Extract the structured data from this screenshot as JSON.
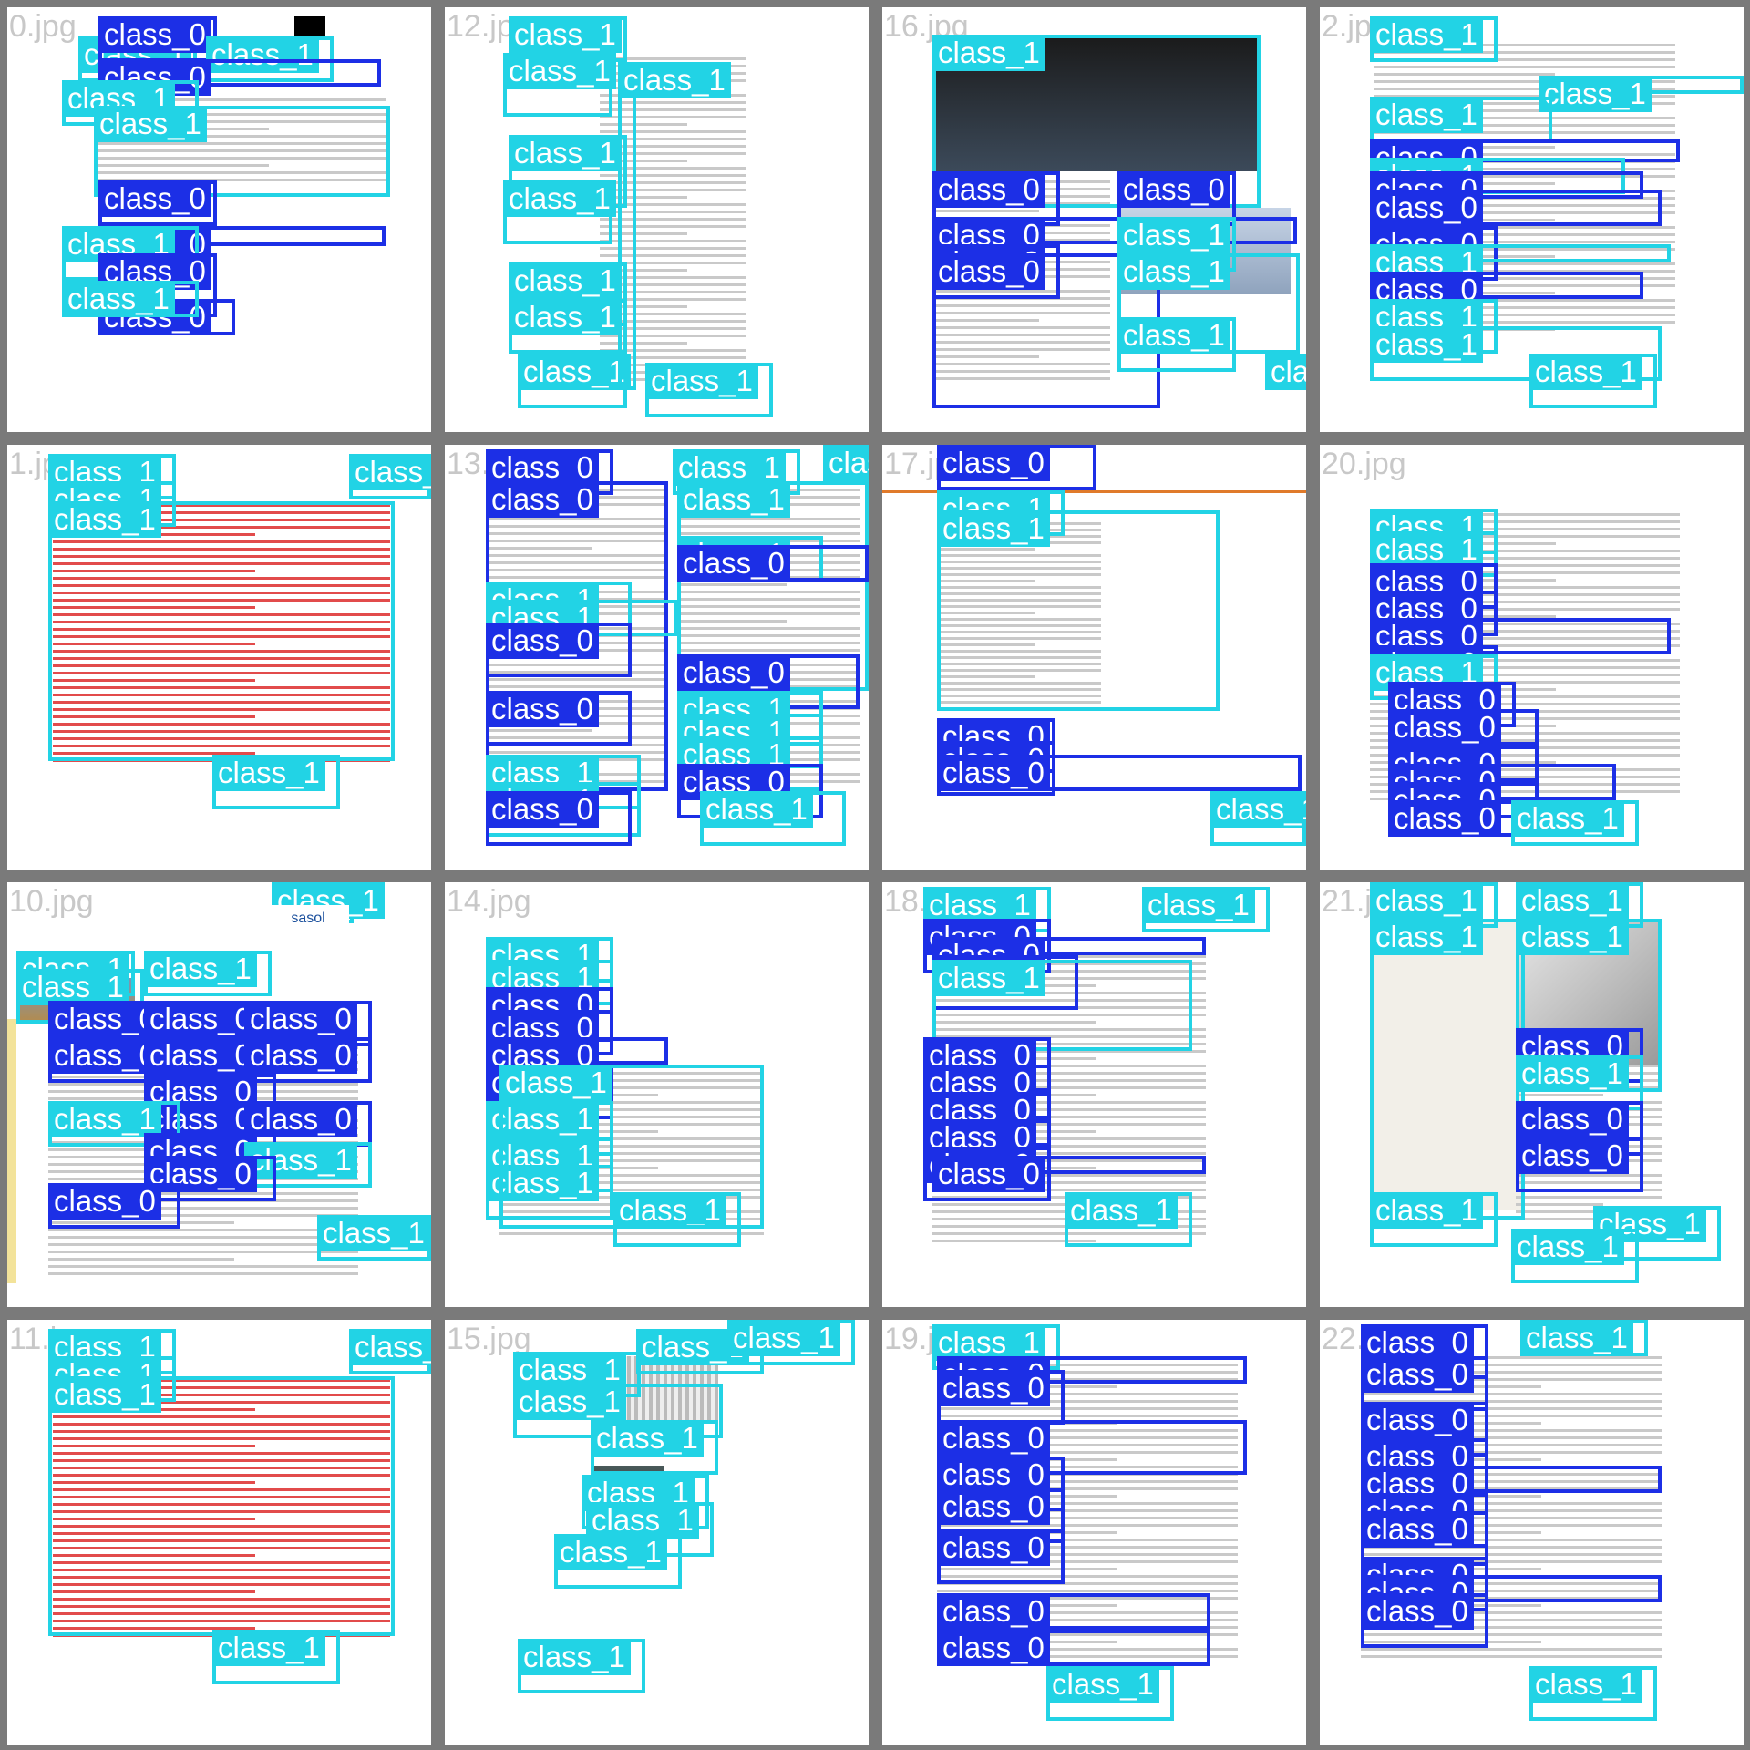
{
  "tiles": [
    {
      "file": "0.jpg"
    },
    {
      "file": "12.jpg"
    },
    {
      "file": "16.jpg"
    },
    {
      "file": "2.jpg"
    },
    {
      "file": "1.jpg"
    },
    {
      "file": "13.jpg"
    },
    {
      "file": "17.jpg"
    },
    {
      "file": "20.jpg"
    },
    {
      "file": "10.jpg"
    },
    {
      "file": "14.jpg"
    },
    {
      "file": "18.jpg"
    },
    {
      "file": "21.jpg"
    },
    {
      "file": "11.jpg"
    },
    {
      "file": "15.jpg"
    },
    {
      "file": "19.jpg"
    },
    {
      "file": "22.jpg"
    }
  ],
  "labels": {
    "c0": "class_0",
    "c1": "class_1"
  },
  "colors": {
    "class_0": "#1c2fe6",
    "class_1": "#22d3e5",
    "tile_border": "#7a7a7a",
    "filename": "#c8c8c8"
  },
  "icons": {
    "logo": "sasol-logo-icon"
  },
  "logo_text": "sasol"
}
